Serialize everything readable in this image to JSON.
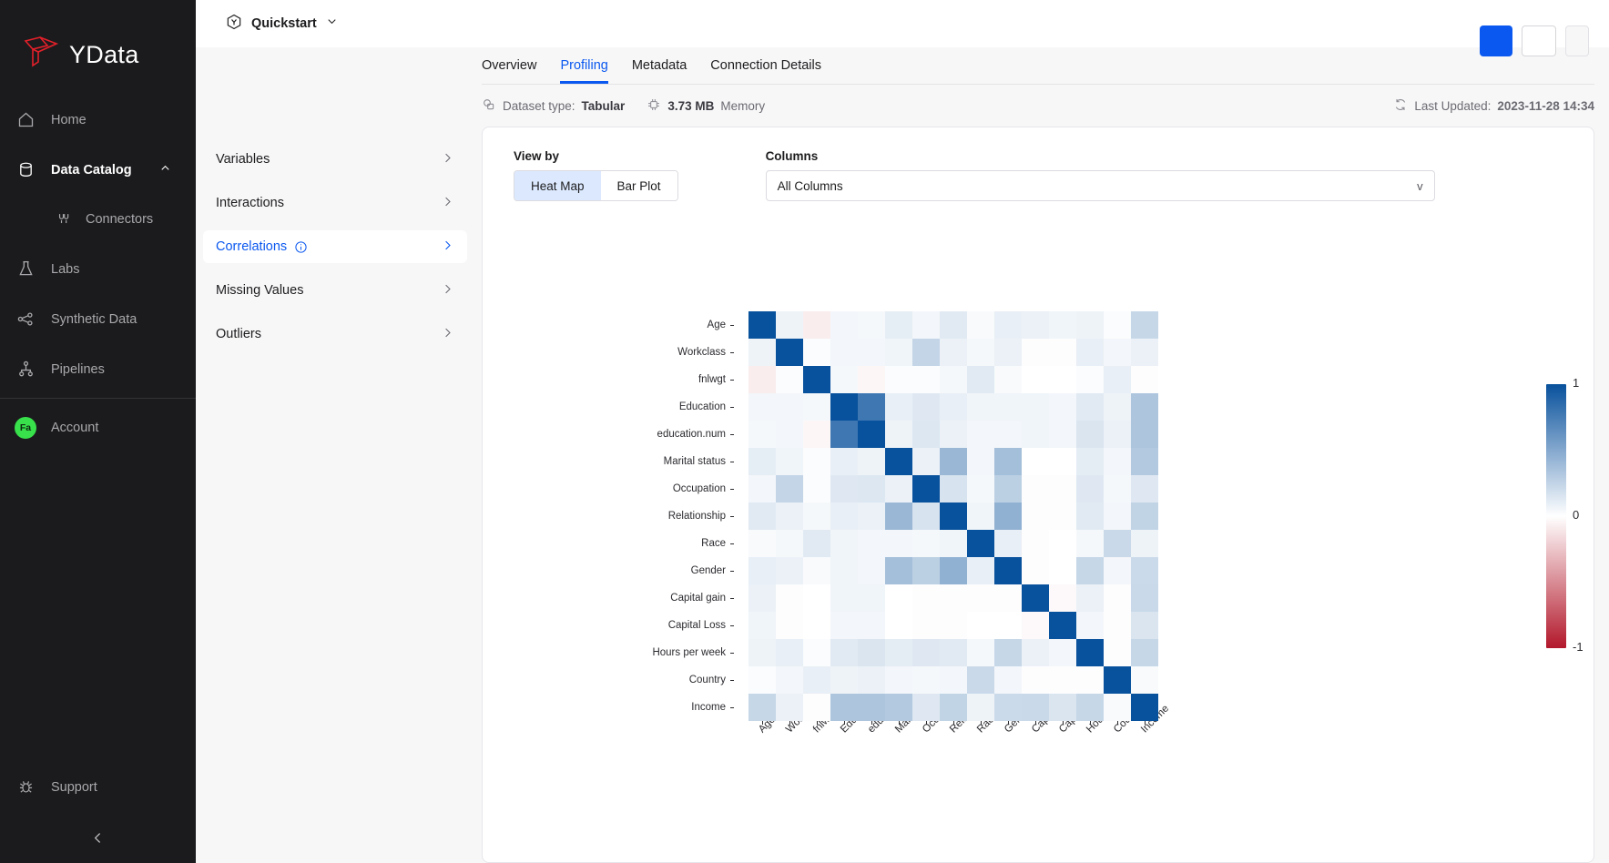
{
  "sidebar": {
    "logo_text": "YData",
    "items": [
      {
        "label": "Home",
        "icon": "home-icon"
      },
      {
        "label": "Data Catalog",
        "icon": "database-icon",
        "expanded": true
      },
      {
        "label": "Connectors",
        "icon": "plug-icon",
        "sub": true
      },
      {
        "label": "Labs",
        "icon": "flask-icon"
      },
      {
        "label": "Synthetic Data",
        "icon": "nodes-icon"
      },
      {
        "label": "Pipelines",
        "icon": "pipeline-icon"
      }
    ],
    "account": {
      "label": "Account",
      "avatar_initials": "Fa",
      "avatar_color": "#38e04b"
    },
    "support": {
      "label": "Support",
      "icon": "bug-icon"
    }
  },
  "topbar": {
    "workspace": "Quickstart",
    "workspace_icon": "cube-icon",
    "chevron_icon": "chevron-down-icon",
    "primary_button": "",
    "outline_button": "",
    "ghost_button": ""
  },
  "tabs": [
    {
      "label": "Overview",
      "active": false
    },
    {
      "label": "Profiling",
      "active": true
    },
    {
      "label": "Metadata",
      "active": false
    },
    {
      "label": "Connection Details",
      "active": false
    }
  ],
  "meta": {
    "dataset_type_label": "Dataset type:",
    "dataset_type_value": "Tabular",
    "dataset_type_icon": "shapes-icon",
    "memory_value": "3.73 MB",
    "memory_label": "Memory",
    "memory_icon": "chip-icon",
    "last_updated_label": "Last Updated:",
    "last_updated_value": "2023-11-28 14:34",
    "last_updated_icon": "refresh-icon"
  },
  "accordion": [
    {
      "label": "Variables",
      "active": false,
      "info": false
    },
    {
      "label": "Interactions",
      "active": false,
      "info": false
    },
    {
      "label": "Correlations",
      "active": true,
      "info": true
    },
    {
      "label": "Missing Values",
      "active": false,
      "info": false
    },
    {
      "label": "Outliers",
      "active": false,
      "info": false
    }
  ],
  "controls": {
    "view_by_label": "View by",
    "view_options": [
      {
        "label": "Heat Map",
        "active": true
      },
      {
        "label": "Bar Plot",
        "active": false
      }
    ],
    "columns_label": "Columns",
    "columns_value": "All Columns",
    "columns_caret": "v"
  },
  "chart_data": {
    "type": "heatmap",
    "title": "",
    "xlabel": "",
    "ylabel": "",
    "colorscale": "RdBu",
    "colorbar": {
      "min": -1,
      "max": 1,
      "ticks": [
        "1",
        "0",
        "-1"
      ],
      "position": "right"
    },
    "categories": [
      "Age",
      "Workclass",
      "fnlwgt",
      "Education",
      "education.num",
      "Marital status",
      "Occupation",
      "Relationship",
      "Race",
      "Gender",
      "Capital gain",
      "Capital Loss",
      "Hours per week",
      "Country",
      "Income"
    ],
    "matrix": [
      [
        1.0,
        0.07,
        -0.08,
        0.05,
        0.04,
        0.1,
        0.05,
        0.12,
        0.03,
        0.09,
        0.08,
        0.06,
        0.07,
        0.02,
        0.23
      ],
      [
        0.07,
        1.0,
        0.02,
        0.05,
        0.05,
        0.06,
        0.24,
        0.08,
        0.04,
        0.08,
        0.01,
        0.01,
        0.09,
        0.05,
        0.08
      ],
      [
        -0.08,
        0.02,
        1.0,
        0.04,
        -0.04,
        0.02,
        0.02,
        0.04,
        0.12,
        0.03,
        0.0,
        0.0,
        0.02,
        0.09,
        0.01
      ],
      [
        0.05,
        0.05,
        0.04,
        1.0,
        0.78,
        0.09,
        0.13,
        0.09,
        0.06,
        0.06,
        0.06,
        0.05,
        0.12,
        0.07,
        0.33
      ],
      [
        0.04,
        0.05,
        -0.04,
        0.78,
        1.0,
        0.07,
        0.14,
        0.08,
        0.05,
        0.05,
        0.06,
        0.05,
        0.15,
        0.08,
        0.33
      ],
      [
        0.1,
        0.06,
        0.02,
        0.09,
        0.07,
        1.0,
        0.08,
        0.41,
        0.05,
        0.37,
        0.0,
        0.0,
        0.11,
        0.05,
        0.31
      ],
      [
        0.05,
        0.24,
        0.02,
        0.13,
        0.14,
        0.08,
        1.0,
        0.16,
        0.04,
        0.27,
        0.01,
        0.01,
        0.13,
        0.04,
        0.13
      ],
      [
        0.12,
        0.08,
        0.04,
        0.09,
        0.08,
        0.41,
        0.16,
        1.0,
        0.06,
        0.45,
        0.01,
        0.01,
        0.12,
        0.05,
        0.25
      ],
      [
        0.03,
        0.04,
        0.12,
        0.06,
        0.05,
        0.05,
        0.04,
        0.06,
        1.0,
        0.09,
        0.01,
        0.0,
        0.04,
        0.22,
        0.07
      ],
      [
        0.09,
        0.08,
        0.03,
        0.06,
        0.05,
        0.37,
        0.27,
        0.45,
        0.09,
        1.0,
        0.01,
        0.0,
        0.23,
        0.05,
        0.21
      ],
      [
        0.08,
        0.01,
        0.0,
        0.06,
        0.06,
        0.0,
        0.01,
        0.01,
        0.01,
        0.01,
        1.0,
        -0.03,
        0.08,
        0.01,
        0.22
      ],
      [
        0.06,
        0.01,
        0.0,
        0.05,
        0.05,
        0.0,
        0.01,
        0.01,
        0.0,
        0.0,
        -0.03,
        1.0,
        0.05,
        0.01,
        0.15
      ],
      [
        0.07,
        0.09,
        0.02,
        0.12,
        0.15,
        0.11,
        0.13,
        0.12,
        0.04,
        0.23,
        0.08,
        0.05,
        1.0,
        0.01,
        0.23
      ],
      [
        0.02,
        0.05,
        0.09,
        0.07,
        0.08,
        0.05,
        0.04,
        0.05,
        0.22,
        0.05,
        0.01,
        0.01,
        0.01,
        1.0,
        0.03
      ],
      [
        0.23,
        0.08,
        0.01,
        0.33,
        0.33,
        0.31,
        0.13,
        0.25,
        0.07,
        0.21,
        0.22,
        0.15,
        0.23,
        0.03,
        1.0
      ]
    ]
  }
}
